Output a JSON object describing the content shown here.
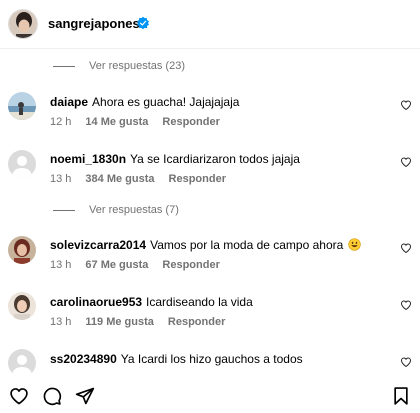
{
  "post": {
    "author": "sangrejaponesa",
    "verified": true
  },
  "view_replies": [
    "Ver respuestas (23)",
    "Ver respuestas (7)"
  ],
  "comments": [
    {
      "user": "daiape",
      "text": "Ahora es guacha! Jajajajaja",
      "time": "12 h",
      "likes": "14 Me gusta",
      "reply": "Responder"
    },
    {
      "user": "noemi_1830n",
      "text": "Ya se Icardiarizaron todos jajaja",
      "time": "13 h",
      "likes": "384 Me gusta",
      "reply": "Responder"
    },
    {
      "user": "solevizcarra2014",
      "text": "Vamos por la moda de campo ahora",
      "time": "13 h",
      "likes": "67 Me gusta",
      "reply": "Responder"
    },
    {
      "user": "carolinaorue953",
      "text": "Icardiseando la vida",
      "time": "13 h",
      "likes": "119 Me gusta",
      "reply": "Responder"
    },
    {
      "user": "ss20234890",
      "text": "Ya Icardi los hizo gauchos a todos",
      "time": "",
      "likes": "",
      "reply": ""
    }
  ],
  "colors": {
    "secondary_text": "#737373",
    "verified_blue": "#0095f6"
  },
  "icons": [
    "heart-icon",
    "comment-icon",
    "share-icon",
    "bookmark-icon",
    "verified-badge-icon",
    "like-comment-icon",
    "grinning-emoji-icon"
  ]
}
